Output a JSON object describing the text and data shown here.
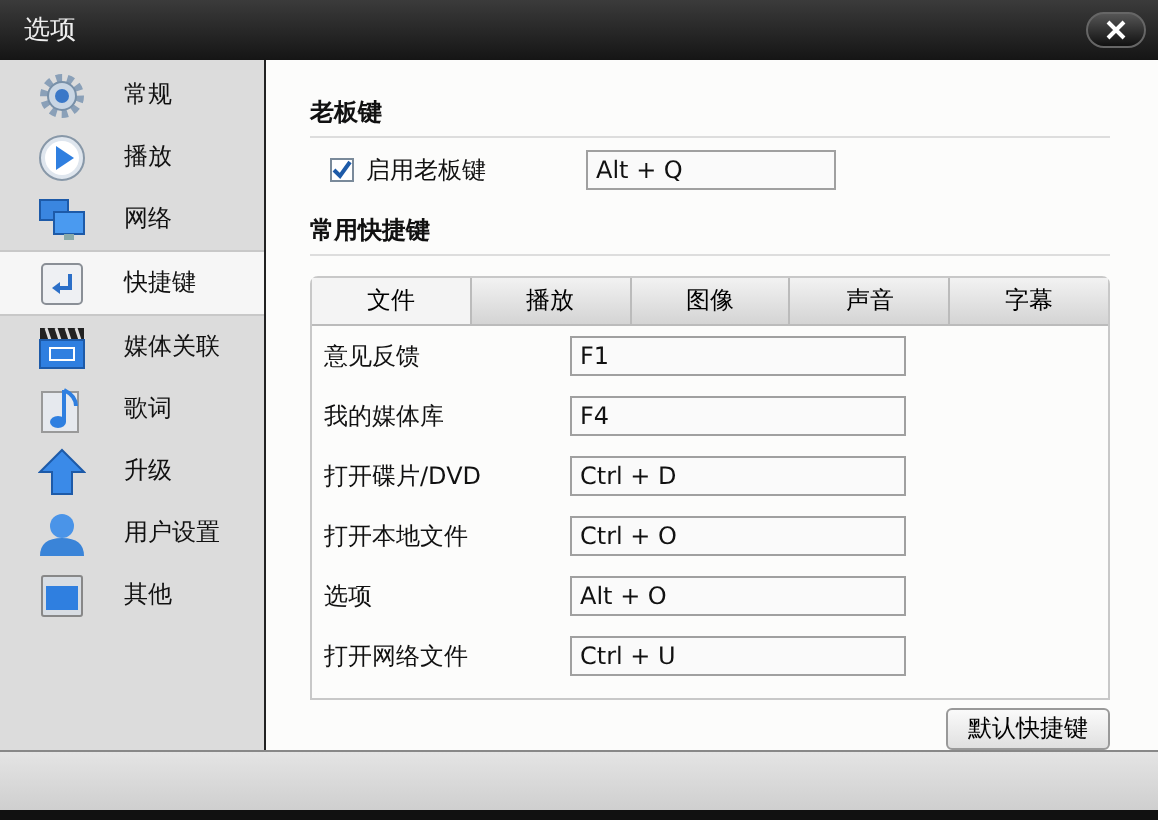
{
  "window": {
    "title": "选项"
  },
  "sidebar": {
    "items": [
      {
        "label": "常规",
        "selected": false
      },
      {
        "label": "播放",
        "selected": false
      },
      {
        "label": "网络",
        "selected": false
      },
      {
        "label": "快捷键",
        "selected": true
      },
      {
        "label": "媒体关联",
        "selected": false
      },
      {
        "label": "歌词",
        "selected": false
      },
      {
        "label": "升级",
        "selected": false
      },
      {
        "label": "用户设置",
        "selected": false
      },
      {
        "label": "其他",
        "selected": false
      }
    ]
  },
  "boss_key": {
    "heading": "老板键",
    "checkbox_label": "启用老板键",
    "checked": true,
    "value": "Alt + Q"
  },
  "shortcuts": {
    "heading": "常用快捷键",
    "tabs": [
      {
        "label": "文件",
        "selected": true
      },
      {
        "label": "播放",
        "selected": false
      },
      {
        "label": "图像",
        "selected": false
      },
      {
        "label": "声音",
        "selected": false
      },
      {
        "label": "字幕",
        "selected": false
      }
    ],
    "rows": [
      {
        "label": "意见反馈",
        "value": "F1"
      },
      {
        "label": "我的媒体库",
        "value": "F4"
      },
      {
        "label": "打开碟片/DVD",
        "value": "Ctrl + D"
      },
      {
        "label": "打开本地文件",
        "value": "Ctrl + O"
      },
      {
        "label": "选项",
        "value": "Alt + O"
      },
      {
        "label": "打开网络文件",
        "value": "Ctrl + U"
      }
    ],
    "default_button": "默认快捷键"
  }
}
